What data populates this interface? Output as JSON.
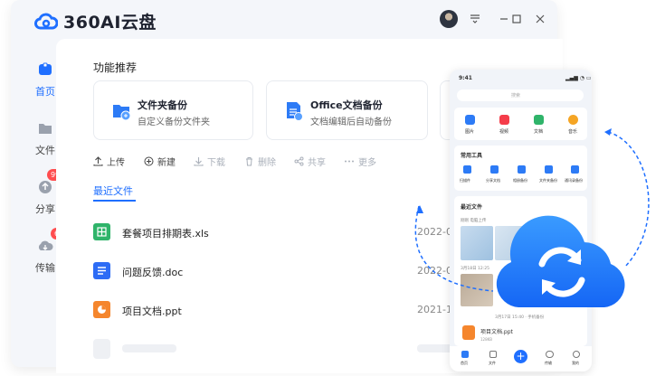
{
  "app": {
    "title": "360AI云盘"
  },
  "window_controls": [
    "menu-icon",
    "minimize-icon",
    "maximize-icon",
    "close-icon"
  ],
  "sidebar": {
    "items": [
      {
        "label": "首页",
        "active": true
      },
      {
        "label": "文件"
      },
      {
        "label": "分享",
        "badge": "99+"
      },
      {
        "label": "传输",
        "badge": "6"
      }
    ]
  },
  "features": {
    "title": "功能推荐",
    "cards": [
      {
        "title": "文件夹备份",
        "subtitle": "自定义备份文件夹"
      },
      {
        "title": "Office文档备份",
        "subtitle": "文档编辑后自动备份"
      }
    ]
  },
  "toolbar": {
    "upload": "上传",
    "new": "新建",
    "download": "下载",
    "delete": "删除",
    "share": "共享",
    "more": "更多"
  },
  "recent": {
    "tab": "最近文件",
    "files": [
      {
        "name": "套餐项目排期表.xls",
        "date": "2022-0",
        "icon": "excel-icon"
      },
      {
        "name": "问题反馈.doc",
        "date": "2022-0",
        "icon": "word-icon"
      },
      {
        "name": "项目文档.ppt",
        "date": "2021-11",
        "icon": "ppt-icon"
      }
    ]
  },
  "phone": {
    "time": "9:41",
    "search_placeholder": "搜索",
    "quick": [
      "图片",
      "视频",
      "文档",
      "音乐"
    ],
    "tools_title": "常用工具",
    "tools": [
      "扫描件",
      "分享文档",
      "相册备份",
      "文件夹备份",
      "通讯录备份"
    ],
    "recent_title": "最近文件",
    "recent_sub": "刚刚  电脑上传",
    "date1": "3月18日 12:25",
    "date2": "3月17日 15:40 · 手机备份",
    "file_name": "项目文档.ppt",
    "file_size": "128KB",
    "tabs": [
      "首页",
      "文件",
      "传输",
      "我的"
    ]
  },
  "colors": {
    "accent": "#1f6fff",
    "badge": "#ff4d4f",
    "excel": "#2fb46a",
    "word": "#2d6cf5",
    "ppt": "#f5862d"
  }
}
